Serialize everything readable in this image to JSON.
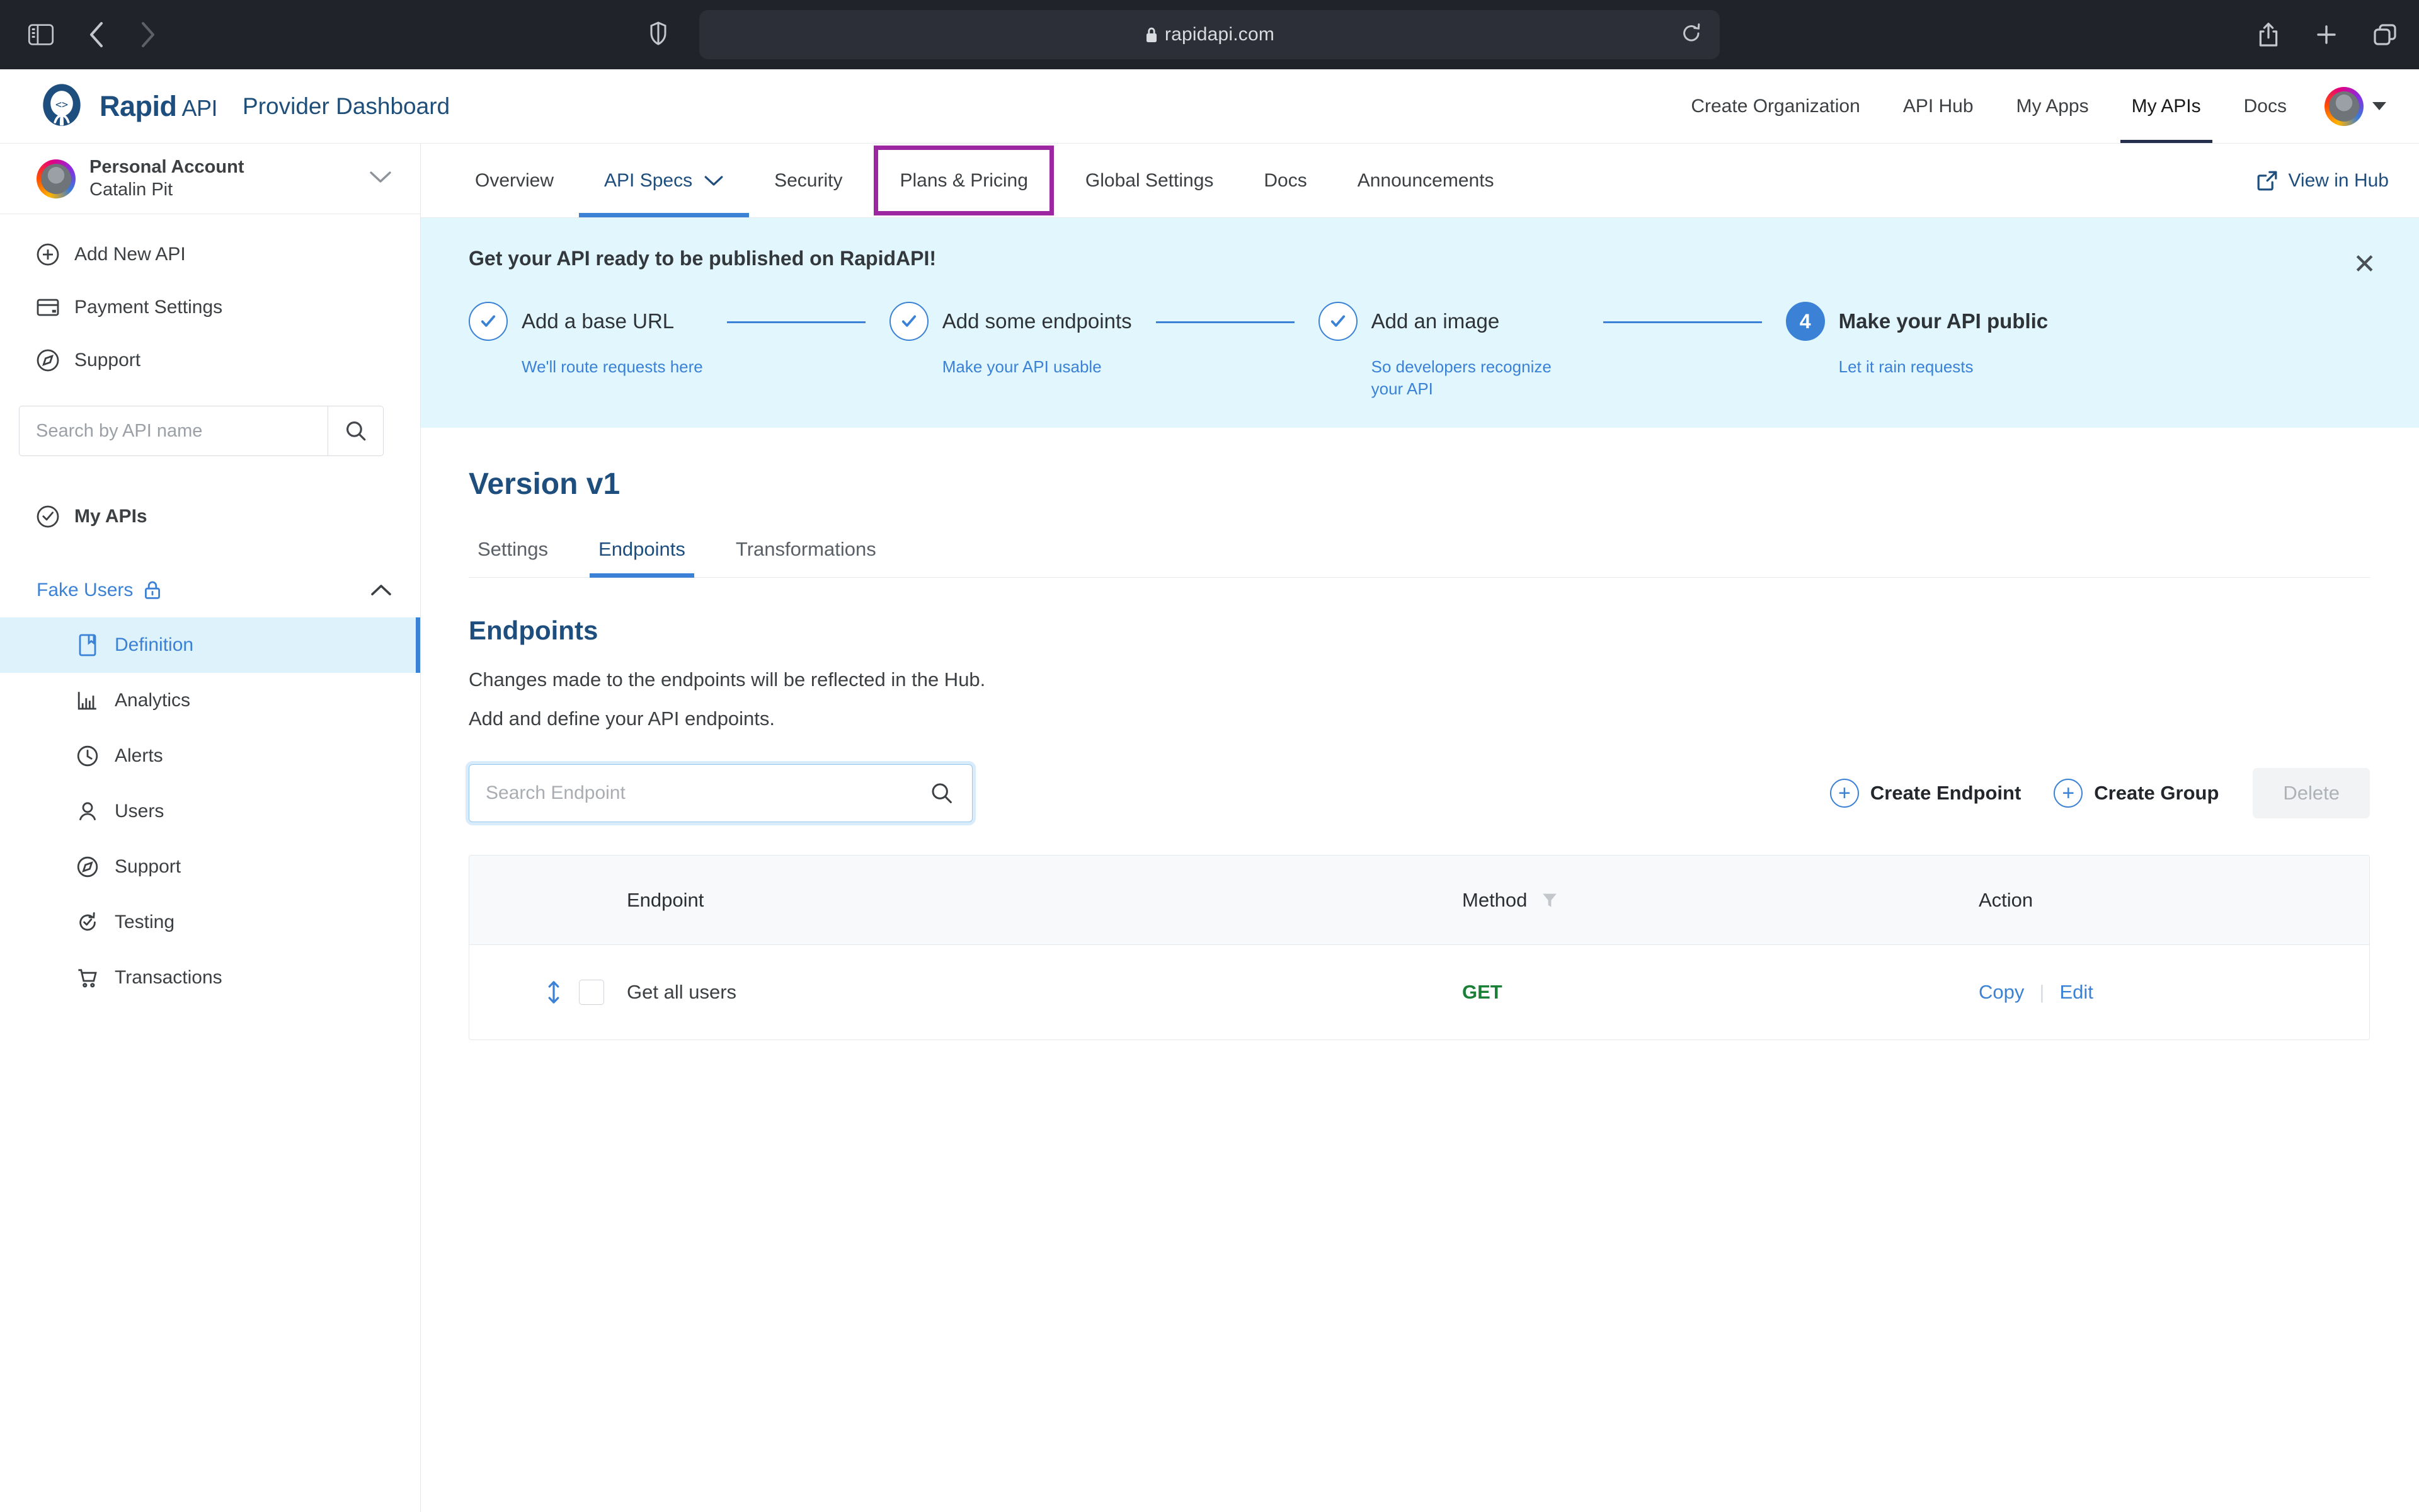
{
  "browser": {
    "url": "rapidapi.com",
    "lock_icon": "lock-icon",
    "sidebar_toggle_icon": "sidebar-toggle-icon",
    "back_icon": "back-arrow-icon",
    "forward_icon": "forward-arrow-icon",
    "shield_icon": "shield-icon",
    "reload_icon": "reload-icon",
    "share_icon": "share-icon",
    "new_tab_icon": "plus-icon",
    "tabs_icon": "tabs-overview-icon"
  },
  "header": {
    "brand": "Rapid",
    "brand_suffix": "API",
    "subtitle": "Provider Dashboard",
    "nav": [
      {
        "label": "Create Organization",
        "active": false
      },
      {
        "label": "API Hub",
        "active": false
      },
      {
        "label": "My Apps",
        "active": false
      },
      {
        "label": "My APIs",
        "active": true
      },
      {
        "label": "Docs",
        "active": false
      }
    ]
  },
  "sidebar": {
    "account": {
      "title": "Personal Account",
      "name": "Catalin Pit",
      "chevron_icon": "chevron-down-icon"
    },
    "primary_items": [
      {
        "label": "Add New API",
        "icon": "plus-circle-icon"
      },
      {
        "label": "Payment Settings",
        "icon": "credit-card-icon"
      },
      {
        "label": "Support",
        "icon": "compass-icon"
      }
    ],
    "search": {
      "placeholder": "Search by API name",
      "value": "",
      "icon": "search-icon"
    },
    "my_apis_label": "My APIs",
    "api_group": {
      "label": "Fake Users",
      "lock_icon": "lock-icon",
      "collapse_icon": "chevron-up-icon"
    },
    "sub_items": [
      {
        "label": "Definition",
        "icon": "book-icon",
        "active": true
      },
      {
        "label": "Analytics",
        "icon": "bar-chart-icon",
        "active": false
      },
      {
        "label": "Alerts",
        "icon": "clock-icon",
        "active": false
      },
      {
        "label": "Users",
        "icon": "user-icon",
        "active": false
      },
      {
        "label": "Support",
        "icon": "compass-icon",
        "active": false
      },
      {
        "label": "Testing",
        "icon": "refresh-check-icon",
        "active": false
      },
      {
        "label": "Transactions",
        "icon": "cart-icon",
        "active": false
      }
    ]
  },
  "tabs": [
    {
      "label": "Overview",
      "active": false,
      "highlighted": false
    },
    {
      "label": "API Specs",
      "active": true,
      "highlighted": false,
      "has_chevron": true
    },
    {
      "label": "Security",
      "active": false,
      "highlighted": false
    },
    {
      "label": "Plans & Pricing",
      "active": false,
      "highlighted": true
    },
    {
      "label": "Global Settings",
      "active": false,
      "highlighted": false
    },
    {
      "label": "Docs",
      "active": false,
      "highlighted": false
    },
    {
      "label": "Announcements",
      "active": false,
      "highlighted": false
    }
  ],
  "view_in_hub": {
    "label": "View in Hub",
    "icon": "external-link-icon"
  },
  "banner": {
    "title": "Get your API ready to be published on RapidAPI!",
    "close_icon": "close-icon",
    "steps": [
      {
        "num": "1",
        "done": true,
        "label": "Add a base URL",
        "sub": "We'll route requests here"
      },
      {
        "num": "2",
        "done": true,
        "label": "Add some endpoints",
        "sub": "Make your API usable"
      },
      {
        "num": "3",
        "done": true,
        "label": "Add an image",
        "sub": "So developers recognize your API"
      },
      {
        "num": "4",
        "done": false,
        "label": "Make your API public",
        "sub": "Let it rain requests"
      }
    ]
  },
  "content": {
    "version_title": "Version v1",
    "sub_tabs": [
      {
        "label": "Settings",
        "active": false
      },
      {
        "label": "Endpoints",
        "active": true
      },
      {
        "label": "Transformations",
        "active": false
      }
    ],
    "section_title": "Endpoints",
    "desc_1": "Changes made to the endpoints will be reflected in the Hub.",
    "desc_2": "Add and define your API endpoints.",
    "search": {
      "placeholder": "Search Endpoint",
      "value": "",
      "icon": "search-icon"
    },
    "create_endpoint_label": "Create Endpoint",
    "create_group_label": "Create Group",
    "delete_label": "Delete",
    "table": {
      "columns": [
        "Endpoint",
        "Method",
        "Action"
      ],
      "filter_icon": "filter-icon",
      "rows": [
        {
          "name": "Get all users",
          "method": "GET",
          "method_color": "#1a7f37",
          "actions": [
            "Copy",
            "Edit"
          ],
          "drag_icon": "drag-handle-icon",
          "checked": false
        }
      ]
    }
  },
  "colors": {
    "accent_blue": "#3b82d6",
    "brand_navy": "#1d4e7d",
    "banner_bg": "#e2f6fd",
    "highlight_purple": "#9c27a0",
    "method_green": "#1a7f37"
  }
}
